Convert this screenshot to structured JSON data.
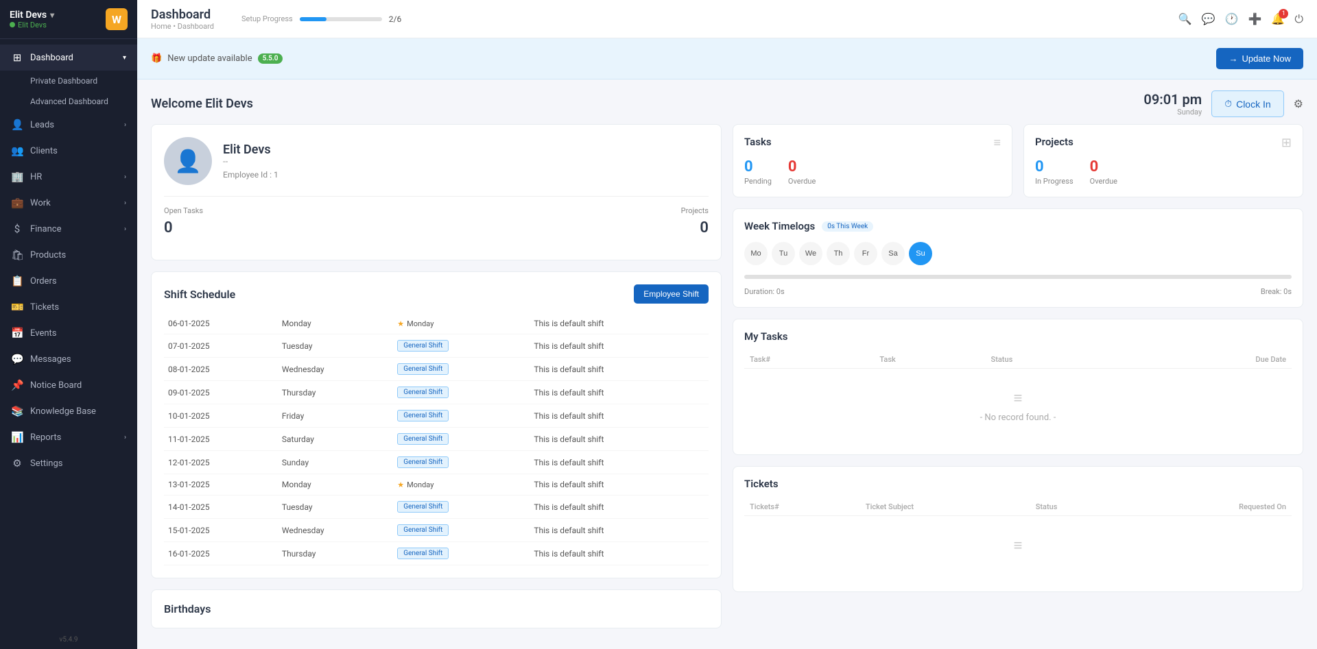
{
  "sidebar": {
    "brand_name": "Elit Devs",
    "brand_sub": "Elit Devs",
    "logo": "W",
    "items": [
      {
        "id": "dashboard",
        "label": "Dashboard",
        "icon": "⊞",
        "has_arrow": true,
        "active": true
      },
      {
        "id": "leads",
        "label": "Leads",
        "icon": "👤",
        "has_arrow": true
      },
      {
        "id": "clients",
        "label": "Clients",
        "icon": "👥",
        "has_arrow": false
      },
      {
        "id": "hr",
        "label": "HR",
        "icon": "🏢",
        "has_arrow": true
      },
      {
        "id": "work",
        "label": "Work",
        "icon": "💼",
        "has_arrow": true
      },
      {
        "id": "finance",
        "label": "Finance",
        "icon": "$",
        "has_arrow": true
      },
      {
        "id": "products",
        "label": "Products",
        "icon": "🛍",
        "has_arrow": false
      },
      {
        "id": "orders",
        "label": "Orders",
        "icon": "📋",
        "has_arrow": false
      },
      {
        "id": "tickets",
        "label": "Tickets",
        "icon": "🎫",
        "has_arrow": false
      },
      {
        "id": "events",
        "label": "Events",
        "icon": "📅",
        "has_arrow": false
      },
      {
        "id": "messages",
        "label": "Messages",
        "icon": "💬",
        "has_arrow": false
      },
      {
        "id": "notice-board",
        "label": "Notice Board",
        "icon": "📌",
        "has_arrow": false
      },
      {
        "id": "knowledge-base",
        "label": "Knowledge Base",
        "icon": "📚",
        "has_arrow": false
      },
      {
        "id": "reports",
        "label": "Reports",
        "icon": "📊",
        "has_arrow": true
      },
      {
        "id": "settings",
        "label": "Settings",
        "icon": "⚙",
        "has_arrow": false
      }
    ],
    "sub_items": [
      {
        "label": "Private Dashboard"
      },
      {
        "label": "Advanced Dashboard"
      }
    ],
    "version": "v5.4.9"
  },
  "topbar": {
    "title": "Dashboard",
    "breadcrumb": "Home • Dashboard",
    "progress_label": "Setup Progress",
    "progress_value": "2/6",
    "progress_percent": 33
  },
  "update_banner": {
    "text": "New update available",
    "version": "5.5.0",
    "btn_label": "Update Now"
  },
  "welcome": {
    "text": "Welcome Elit Devs",
    "time": "09:01 pm",
    "day": "Sunday",
    "clock_in_label": "Clock In",
    "gear_icon": "⚙"
  },
  "profile": {
    "name": "Elit Devs",
    "dash": "--",
    "employee_id": "Employee Id : 1",
    "open_tasks_label": "Open Tasks",
    "open_tasks_value": "0",
    "projects_label": "Projects",
    "projects_value": "0"
  },
  "shift_schedule": {
    "title": "Shift Schedule",
    "btn_label": "Employee Shift",
    "rows": [
      {
        "date": "06-01-2025",
        "day": "Monday",
        "shift": "Monday",
        "shift_type": "star",
        "desc": "This is default shift"
      },
      {
        "date": "07-01-2025",
        "day": "Tuesday",
        "shift": "General Shift",
        "shift_type": "badge",
        "desc": "This is default shift"
      },
      {
        "date": "08-01-2025",
        "day": "Wednesday",
        "shift": "General Shift",
        "shift_type": "badge",
        "desc": "This is default shift"
      },
      {
        "date": "09-01-2025",
        "day": "Thursday",
        "shift": "General Shift",
        "shift_type": "badge",
        "desc": "This is default shift"
      },
      {
        "date": "10-01-2025",
        "day": "Friday",
        "shift": "General Shift",
        "shift_type": "badge",
        "desc": "This is default shift"
      },
      {
        "date": "11-01-2025",
        "day": "Saturday",
        "shift": "General Shift",
        "shift_type": "badge",
        "desc": "This is default shift"
      },
      {
        "date": "12-01-2025",
        "day": "Sunday",
        "shift": "General Shift",
        "shift_type": "badge",
        "desc": "This is default shift"
      },
      {
        "date": "13-01-2025",
        "day": "Monday",
        "shift": "Monday",
        "shift_type": "star",
        "desc": "This is default shift"
      },
      {
        "date": "14-01-2025",
        "day": "Tuesday",
        "shift": "General Shift",
        "shift_type": "badge",
        "desc": "This is default shift"
      },
      {
        "date": "15-01-2025",
        "day": "Wednesday",
        "shift": "General Shift",
        "shift_type": "badge",
        "desc": "This is default shift"
      },
      {
        "date": "16-01-2025",
        "day": "Thursday",
        "shift": "General Shift",
        "shift_type": "badge",
        "desc": "This is default shift"
      }
    ]
  },
  "birthdays": {
    "title": "Birthdays"
  },
  "tasks_card": {
    "title": "Tasks",
    "pending_label": "Pending",
    "pending_value": "0",
    "overdue_label": "Overdue",
    "overdue_value": "0"
  },
  "projects_card": {
    "title": "Projects",
    "in_progress_label": "In Progress",
    "in_progress_value": "0",
    "overdue_label": "Overdue",
    "overdue_value": "0"
  },
  "timelogs": {
    "title": "Week Timelogs",
    "badge": "0s This Week",
    "days": [
      "Mo",
      "Tu",
      "We",
      "Th",
      "Fr",
      "Sa",
      "Su"
    ],
    "active_day": 6,
    "duration": "Duration: 0s",
    "break": "Break: 0s"
  },
  "my_tasks": {
    "title": "My Tasks",
    "columns": [
      "Task#",
      "Task",
      "Status",
      "Due Date"
    ],
    "no_record": "- No record found. -"
  },
  "tickets": {
    "title": "Tickets",
    "columns": [
      "Tickets#",
      "Ticket Subject",
      "Status",
      "Requested On"
    ]
  }
}
